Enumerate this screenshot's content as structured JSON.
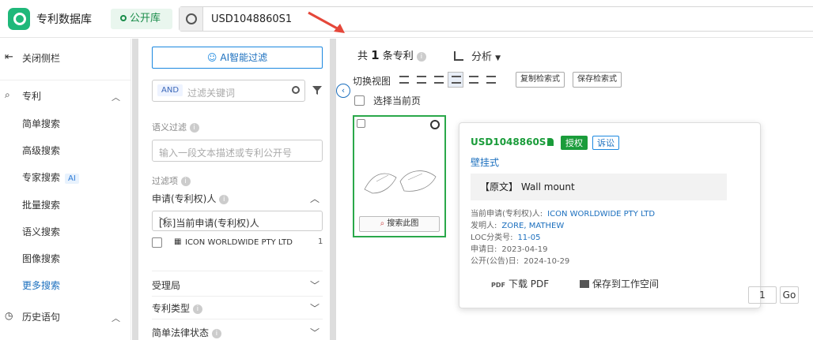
{
  "app": {
    "title": "专利数据库",
    "library_label": "公开库"
  },
  "search": {
    "query": "USD1048860S1"
  },
  "sidebar": {
    "close_label": "关闭侧栏",
    "patent_label": "专利",
    "items": [
      {
        "label": "简单搜索"
      },
      {
        "label": "高级搜索"
      },
      {
        "label": "专家搜索",
        "tag": "AI"
      },
      {
        "label": "批量搜索"
      },
      {
        "label": "语义搜索"
      },
      {
        "label": "图像搜索"
      },
      {
        "label": "更多搜索"
      }
    ],
    "history_label": "历史语句"
  },
  "filters": {
    "ai_filter_label": "AI智能过滤",
    "and_label": "AND",
    "keyword_placeholder": "过滤关键词",
    "semantic_label": "语义过滤",
    "semantic_placeholder": "输入一段文本描述或专利公开号",
    "filter_items_label": "过滤项",
    "applicant_group": "申请(专利权)人",
    "applicant_select": "[标]当前申请(专利权)人",
    "applicant_name": "ICON WORLDWIDE PTY LTD",
    "applicant_count": "1",
    "group_office": "受理局",
    "group_type": "专利类型",
    "group_legal": "简单法律状态"
  },
  "results": {
    "total_prefix": "共",
    "total_count": "1",
    "total_suffix": "条专利",
    "analysis_label": "分析",
    "view_label": "切换视图",
    "copy_query_label": "复制检索式",
    "save_query_label": "保存检索式",
    "select_page_label": "选择当前页",
    "search_this_label": "搜索此图"
  },
  "card": {
    "patent_number": "USD1048860S1",
    "grant_badge": "授权",
    "litigation_badge": "诉讼",
    "title": "壁挂式",
    "original_label": "【原文】",
    "original_text": "Wall mount",
    "applicant_label": "当前申请(专利权)人:",
    "applicant_value": "ICON WORLDWIDE PTY LTD",
    "inventor_label": "发明人:",
    "inventor_value": "ZORE, MATHEW",
    "loc_label": "LOC分类号:",
    "loc_value": "11-05",
    "filing_label": "申请日:",
    "filing_value": "2023-04-19",
    "pub_label": "公开(公告)日:",
    "pub_value": "2024-10-29",
    "pdf_label": "下载 PDF",
    "pdf_icon": "PDF",
    "save_workspace_label": "保存到工作空间"
  },
  "pagination": {
    "page": "1",
    "go_label": "Go"
  },
  "colors": {
    "accent": "#1b6fbe",
    "green": "#1a9c3a",
    "border": "#2aa84a"
  }
}
